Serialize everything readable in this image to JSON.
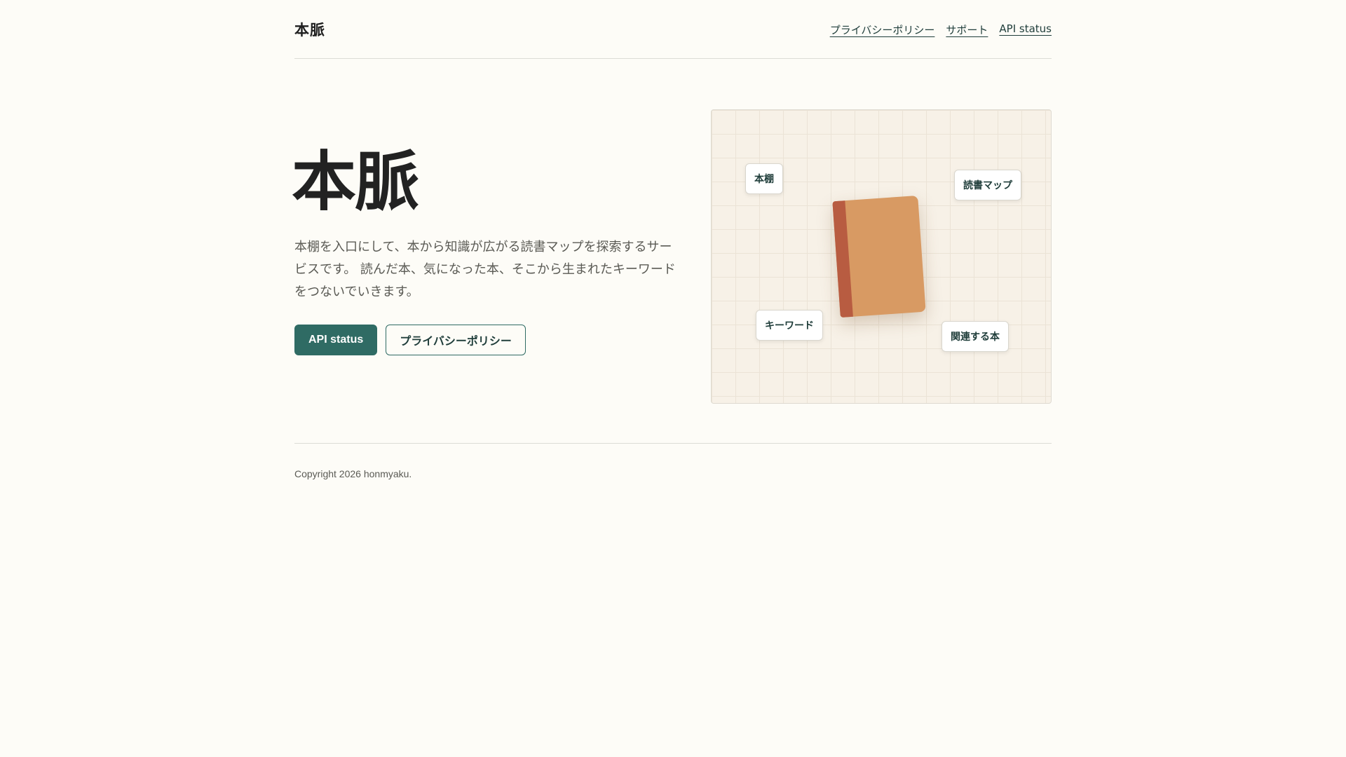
{
  "header": {
    "brand": "本脈",
    "nav": [
      "プライバシーポリシー",
      "サポート",
      "API status"
    ]
  },
  "hero": {
    "title": "本脈",
    "description": "本棚を入口にして、本から知識が広がる読書マップを探索するサービスです。 読んだ本、気になった本、そこから生まれたキーワードをつないでいきます。",
    "primary_button": "API status",
    "secondary_button": "プライバシーポリシー"
  },
  "illustration": {
    "chips": [
      "本棚",
      "読書マップ",
      "キーワード",
      "関連する本"
    ],
    "colors": {
      "background": "#f7f1e7",
      "grid": "#ebe3d6",
      "book_cover": "#d89a63",
      "book_spine": "#b85c41"
    }
  },
  "footer": {
    "copyright": "Copyright 2026 honmyaku."
  },
  "colors": {
    "accent": "#2f6b64",
    "page_background": "#fdfcf7",
    "link": "#1f3d3a"
  }
}
